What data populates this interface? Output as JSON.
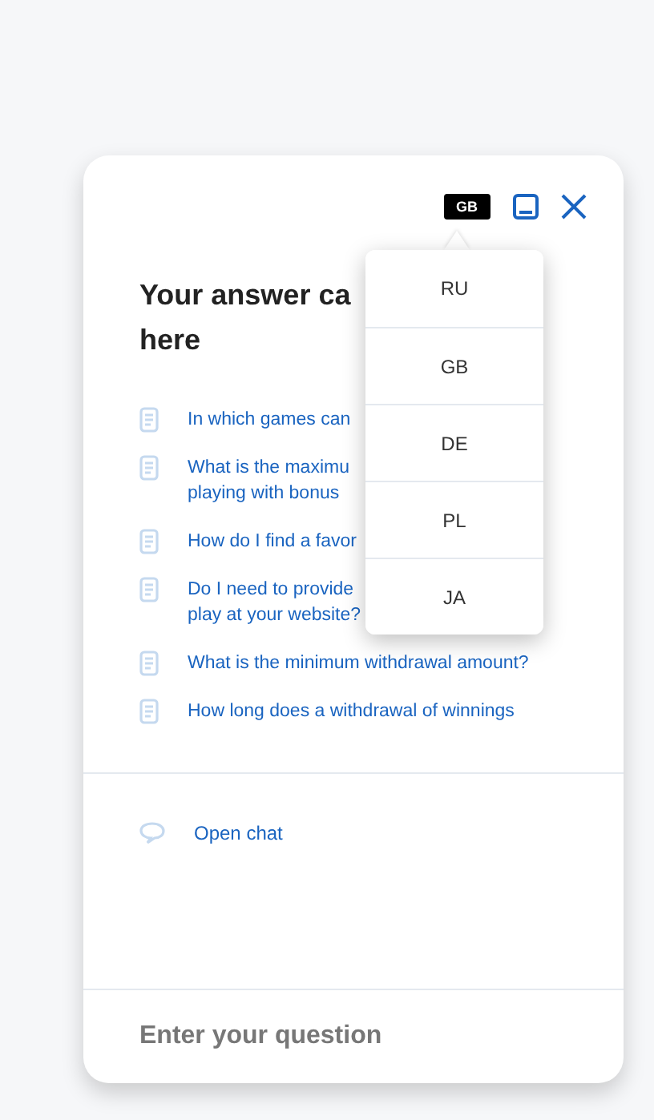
{
  "header": {
    "language_badge": "GB"
  },
  "title_lines": [
    "Your answer ca",
    "here"
  ],
  "questions": [
    {
      "lines": [
        "In which games can"
      ]
    },
    {
      "lines": [
        "What is the maximu",
        "playing with bonus"
      ]
    },
    {
      "lines": [
        "How do I find a favor"
      ]
    },
    {
      "lines": [
        "Do I need to provide",
        "play at your website?"
      ]
    },
    {
      "lines": [
        "What is the minimum withdrawal amount?"
      ]
    },
    {
      "lines": [
        "How long does a withdrawal of winnings"
      ]
    }
  ],
  "open_chat": "Open chat",
  "question_input": {
    "placeholder": "Enter your question"
  },
  "language_menu": [
    "RU",
    "GB",
    "DE",
    "PL",
    "JA"
  ]
}
